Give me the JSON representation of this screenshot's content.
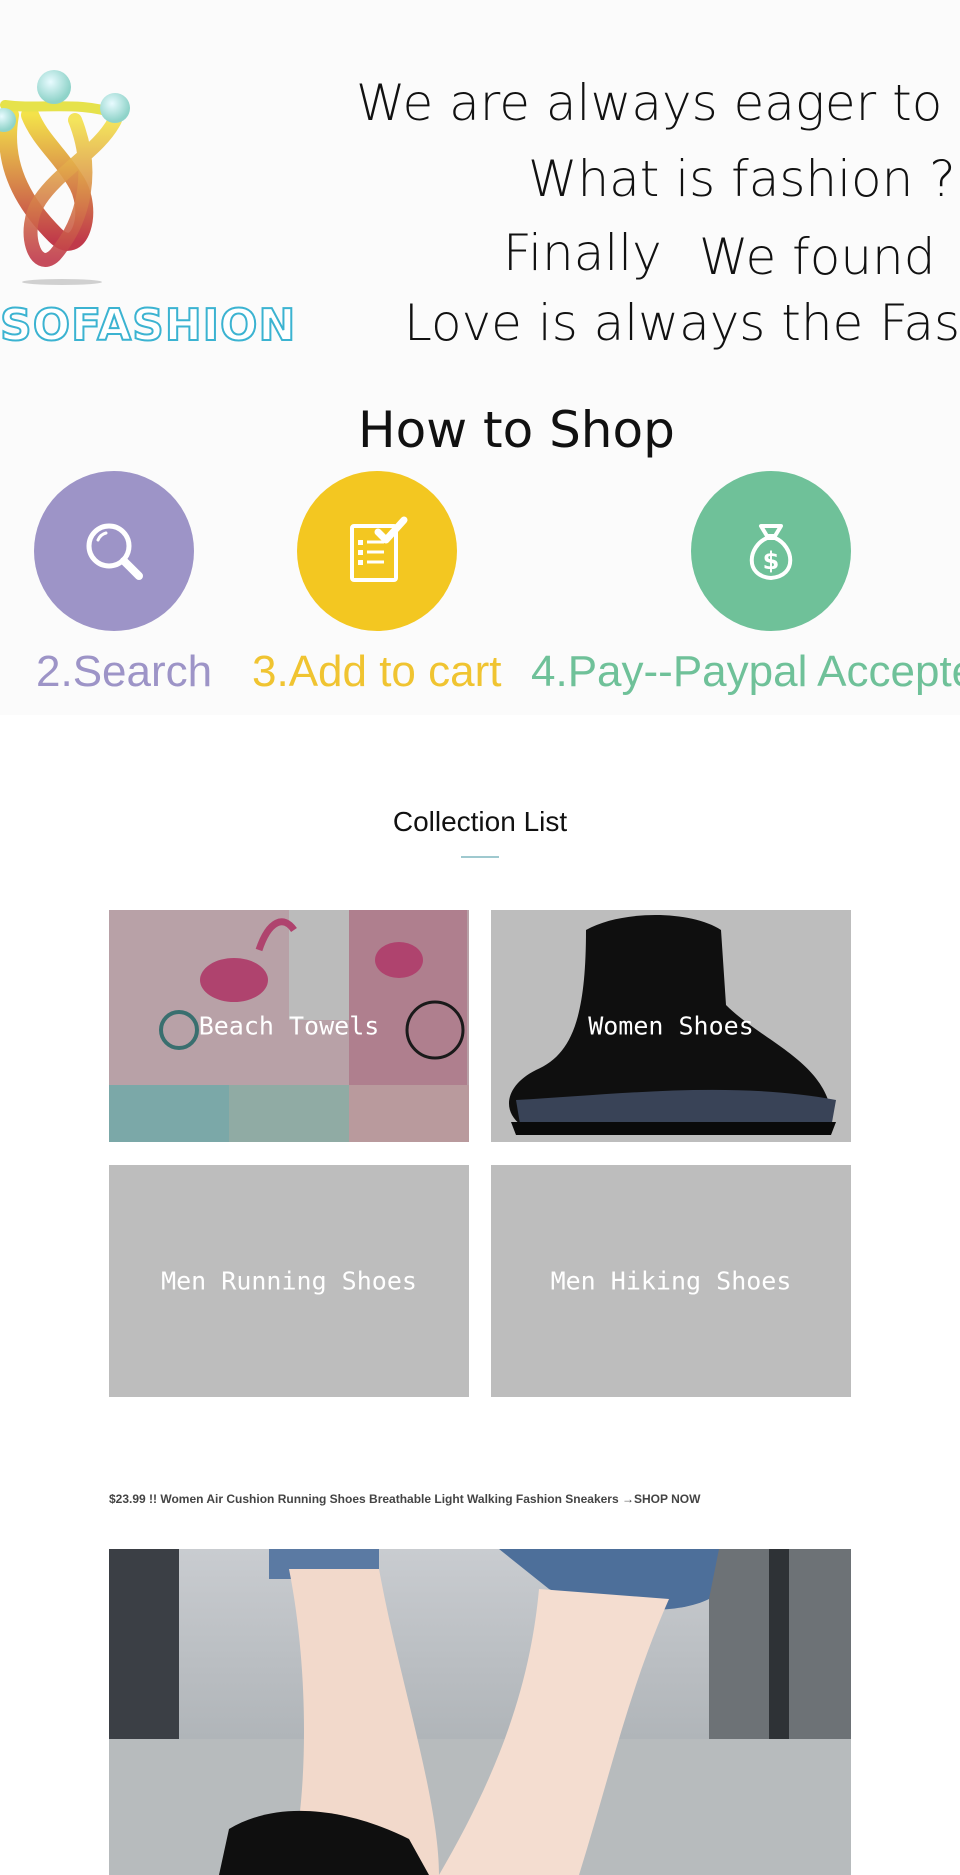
{
  "hero": {
    "brand": "SOFASHION",
    "tagline": {
      "line1": "We are always eager to",
      "line2": "What is fashion ?",
      "line3a": "Finally",
      "line3b": "We found",
      "line4": "Love is always the Fash"
    },
    "how_to_shop": {
      "title": "How to Shop",
      "steps": [
        {
          "label": "2.Search",
          "icon": "search-icon",
          "color": "#9d94c7"
        },
        {
          "label": "3.Add to cart",
          "icon": "checklist-icon",
          "color": "#f3c721"
        },
        {
          "label": "4.Pay--Paypal Accepte",
          "icon": "money-bag-icon",
          "color": "#6fc199"
        }
      ]
    }
  },
  "collection_list": {
    "title": "Collection List",
    "items": [
      {
        "label": "Beach Towels"
      },
      {
        "label": "Women Shoes"
      },
      {
        "label": "Men Running Shoes"
      },
      {
        "label": "Men Hiking Shoes"
      }
    ]
  },
  "promo": {
    "link_text": "$23.99 !! Women Air Cushion Running Shoes Breathable Light Walking Fashion Sneakers →SHOP NOW"
  },
  "colors": {
    "accent_rule": "#9fc9cf",
    "brand_blue": "#3bb3d1",
    "tile_gray": "#bdbdbd"
  }
}
